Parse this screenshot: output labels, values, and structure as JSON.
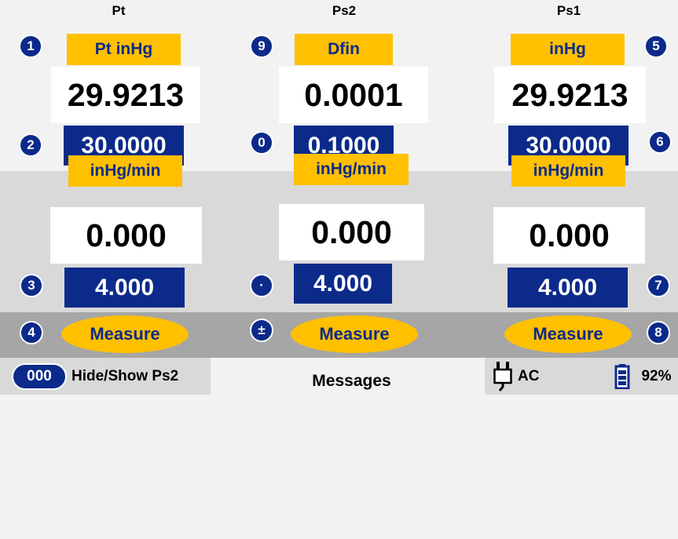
{
  "columns": [
    {
      "title": "Pt",
      "label": "Pt inHg",
      "value": "29.9213",
      "setpoint": "30.0000",
      "rate_label": "inHg/min",
      "rate_value": "0.000",
      "rate_setpoint": "4.000",
      "action": "Measure",
      "keys": {
        "label": "1",
        "setpoint": "2",
        "rate": "3",
        "action": "4"
      }
    },
    {
      "title": "Ps2",
      "label": "Dfin",
      "value": "0.0001",
      "setpoint": "0.1000",
      "rate_label": "inHg/min",
      "rate_value": "0.000",
      "rate_setpoint": "4.000",
      "action": "Measure",
      "keys": {
        "label": "9",
        "setpoint": "0",
        "rate": "·",
        "action": "±"
      }
    },
    {
      "title": "Ps1",
      "label": "inHg",
      "value": "29.9213",
      "setpoint": "30.0000",
      "rate_label": "inHg/min",
      "rate_value": "0.000",
      "rate_setpoint": "4.000",
      "action": "Measure",
      "keys": {
        "label": "5",
        "setpoint": "6",
        "rate": "7",
        "action": "8"
      }
    }
  ],
  "footer": {
    "toggle_key": "000",
    "toggle_label": "Hide/Show Ps2",
    "messages": "Messages",
    "power_source": "AC",
    "battery": "92%"
  },
  "colors": {
    "navy": "#0b2a8a",
    "amber": "#ffc000",
    "band_light": "#d9d9d9",
    "band_dark": "#a6a6a6",
    "background": "#f2f2f2"
  }
}
